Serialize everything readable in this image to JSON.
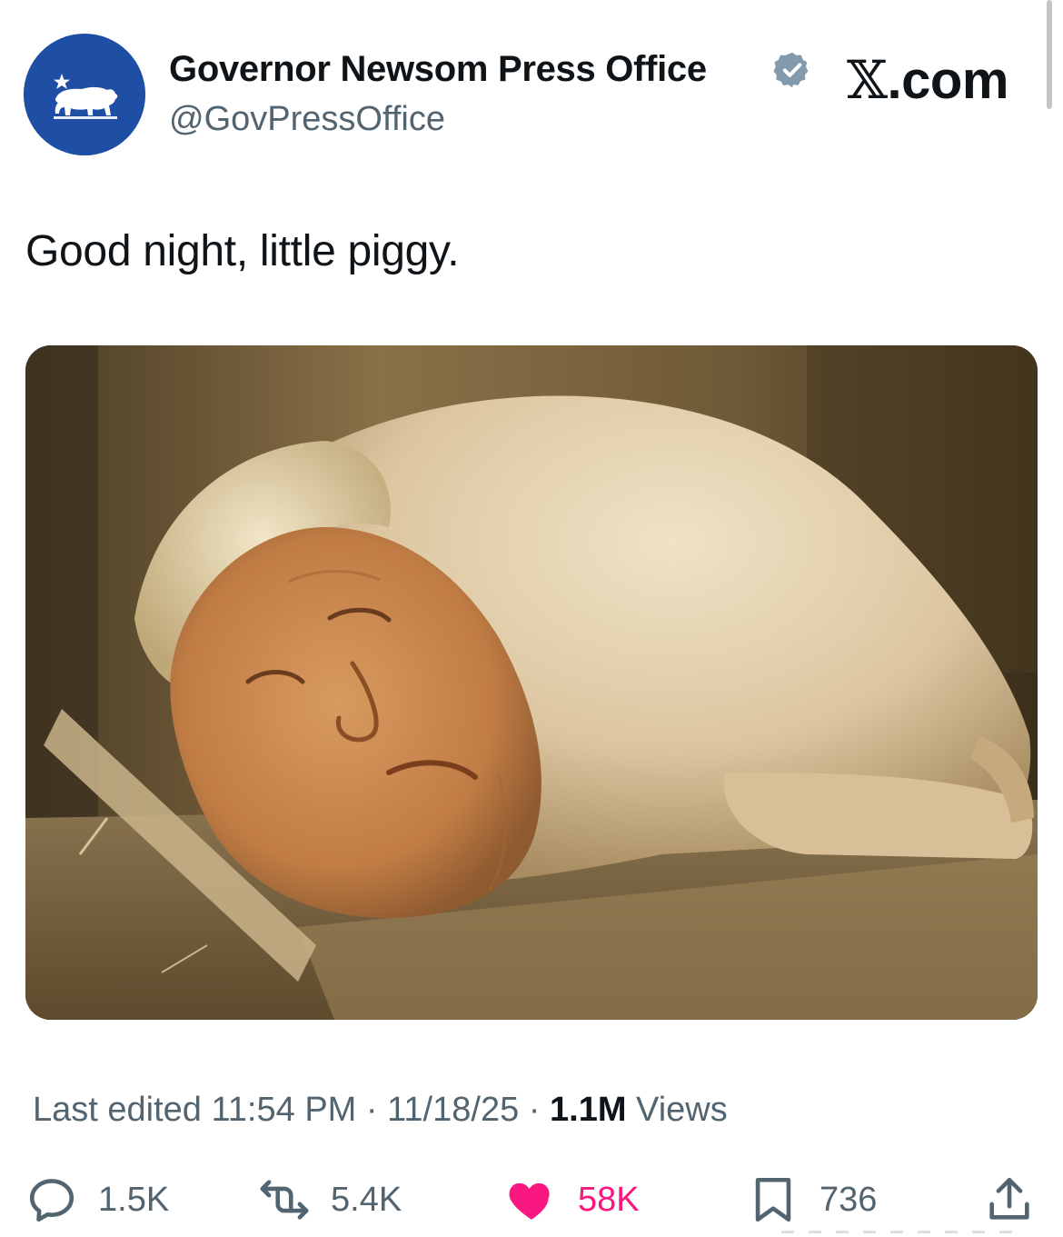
{
  "header": {
    "display_name": "Governor Newsom Press Office",
    "handle": "@GovPressOffice",
    "site_label": ".com",
    "site_logo_glyph": "𝕏",
    "avatar_icon": "california-bear-star-icon",
    "verified_icon": "verified-badge-icon"
  },
  "tweet": {
    "text": "Good night, little piggy."
  },
  "media": {
    "kind": "photo",
    "subject": "sleeping-pig-image"
  },
  "meta": {
    "edited_prefix": "Last edited",
    "time": "11:54 PM",
    "separator": "·",
    "date": "11/18/25",
    "views_count": "1.1M",
    "views_label": "Views"
  },
  "actions": {
    "reply": {
      "icon": "reply-icon",
      "count": "1.5K"
    },
    "repost": {
      "icon": "repost-icon",
      "count": "5.4K"
    },
    "like": {
      "icon": "heart-icon",
      "count": "58K",
      "color": "#f91880"
    },
    "bookmark": {
      "icon": "bookmark-icon",
      "count": "736"
    },
    "share": {
      "icon": "share-icon"
    }
  },
  "colors": {
    "avatar_bg": "#1f4fa4",
    "secondary_text": "#536471",
    "primary_text": "#0f1419",
    "verified_badge": "#829aab",
    "like_active": "#f91880"
  }
}
